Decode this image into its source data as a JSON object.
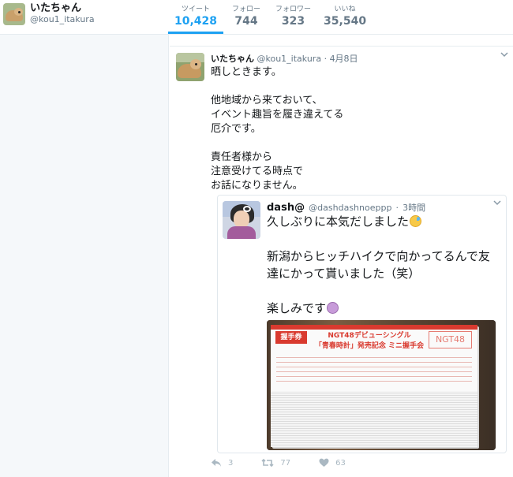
{
  "profile": {
    "name": "いたちゃん",
    "handle": "@kou1_itakura"
  },
  "stats": [
    {
      "label": "ツイート",
      "value": "10,428",
      "active": true
    },
    {
      "label": "フォロー",
      "value": "744",
      "active": false
    },
    {
      "label": "フォロワー",
      "value": "323",
      "active": false
    },
    {
      "label": "いいね",
      "value": "35,540",
      "active": false
    }
  ],
  "tweet": {
    "author_name": "いたちゃん",
    "author_handle": "@kou1_itakura",
    "separator": "·",
    "time": "4月8日",
    "paragraphs": [
      "晒しときます。",
      "他地域から来ておいて、\nイベント趣旨を履き違えてる\n厄介です。",
      "責任者様から\n注意受けてる時点で\nお話になりません。"
    ],
    "actions": {
      "reply_count": "3",
      "retweet_count": "77",
      "like_count": "63"
    }
  },
  "quoted": {
    "author_name": "dash@",
    "author_handle": "@dashdashnoeppp",
    "separator": "·",
    "time": "3時間",
    "line1": "久しぶりに本気だしました",
    "paragraph2": "新潟からヒッチハイクで向かってるんで友\n達にかって貰いました（笑）",
    "line3": "楽しみです",
    "photo": {
      "tag": "握手券",
      "title1": "NGT48デビューシングル",
      "title2": "「青春時計」発売記念 ミニ握手会",
      "logo": "NGT48"
    }
  },
  "colors": {
    "accent": "#1da1f2",
    "muted": "#657786",
    "ticket_red": "#d93a2f"
  },
  "icons": [
    "reply-icon",
    "retweet-icon",
    "heart-icon",
    "chevron-down-icon"
  ]
}
